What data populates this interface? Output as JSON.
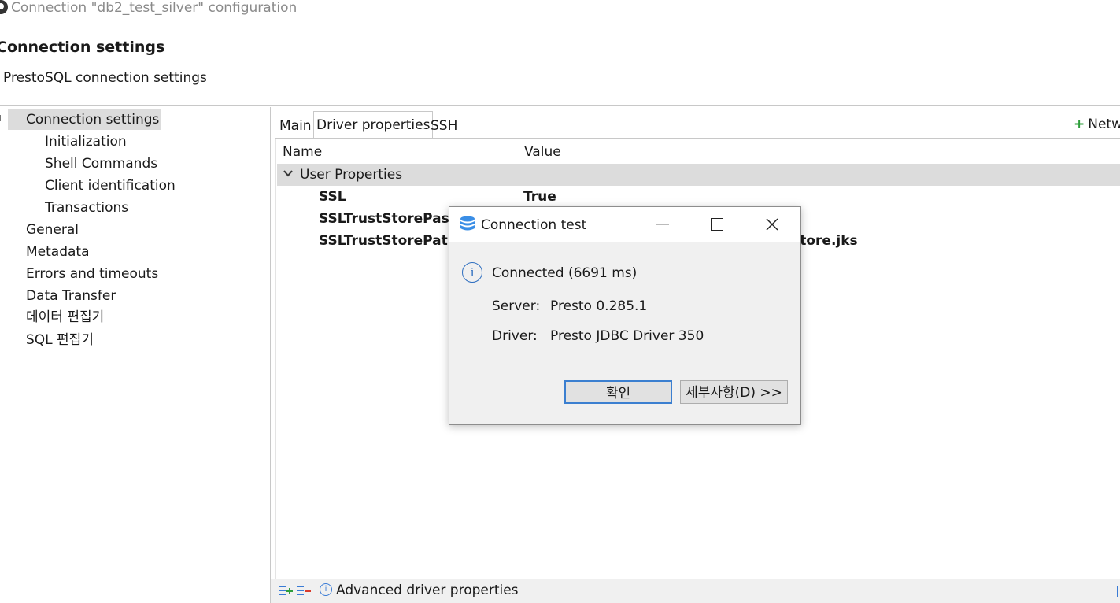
{
  "window": {
    "title": "Connection \"db2_test_silver\" configuration"
  },
  "header": {
    "title": "Connection settings",
    "subtitle": "PrestoSQL connection settings"
  },
  "nav": {
    "items": [
      {
        "label": "Connection settings"
      },
      {
        "label": "Initialization"
      },
      {
        "label": "Shell Commands"
      },
      {
        "label": "Client identification"
      },
      {
        "label": "Transactions"
      },
      {
        "label": "General"
      },
      {
        "label": "Metadata"
      },
      {
        "label": "Errors and timeouts"
      },
      {
        "label": "Data Transfer"
      },
      {
        "label": "데이터 편집기"
      },
      {
        "label": "SQL 편집기"
      }
    ]
  },
  "tabs": [
    {
      "label": "Main"
    },
    {
      "label": "Driver properties"
    },
    {
      "label": "SSH"
    }
  ],
  "network_button": {
    "label": "Netw"
  },
  "table": {
    "columns": [
      "Name",
      "Value"
    ],
    "group": "User Properties",
    "rows": [
      {
        "name": "SSL",
        "value": "True"
      },
      {
        "name": "SSLTrustStorePassw",
        "value": ""
      },
      {
        "name": "SSLTrustStorePath",
        "value": "tstore.jks"
      }
    ]
  },
  "footer": {
    "label": "Advanced driver properties"
  },
  "dialog": {
    "title": "Connection test",
    "message": "Connected (6691 ms)",
    "server_label": "Server:",
    "server_value": "Presto 0.285.1",
    "driver_label": "Driver:",
    "driver_value": "Presto JDBC Driver 350",
    "ok_button": "확인",
    "details_button": "세부사항(D) >>"
  },
  "colors": {
    "accent": "#3b7fd0",
    "selection": "#dcdcdc",
    "add_green": "#2e9e3b",
    "delete_red": "#d93a2b"
  }
}
